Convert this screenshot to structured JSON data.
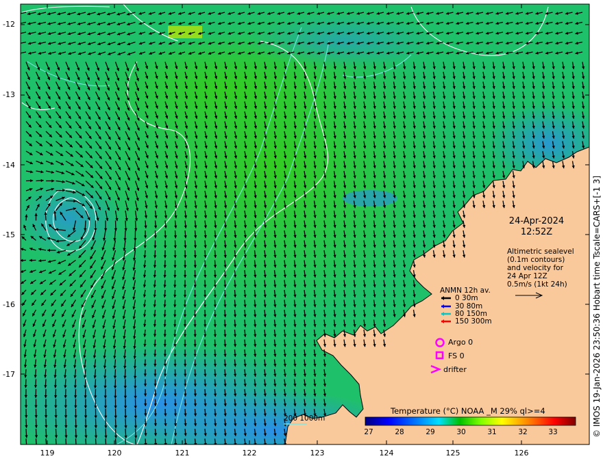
{
  "map": {
    "datetime_line1": "24-Apr-2024",
    "datetime_line2": "12:52Z",
    "altimetry_note": [
      "Altimetric sealevel",
      "(0.1m contours)",
      "and velocity for",
      "24 Apr 12Z",
      "0.5m/s (1kt 24h)"
    ],
    "lat_ticks": [
      "-12",
      "-13",
      "-14",
      "-15",
      "-16",
      "-17"
    ],
    "lon_ticks": [
      "119",
      "120",
      "121",
      "122",
      "123",
      "124",
      "125",
      "126"
    ],
    "credit": "© IMOS 19-Jan-2026 23:50:36 Hobart time Tscale=CARS+[-1 3]",
    "depth_contours_label": "200 1000m",
    "colors": {
      "land": "#f9c89b",
      "contour_white": "#ffffff",
      "contour_cyan": "#7ee8e8",
      "arrow": "#000000",
      "marker": "#ff00ff"
    }
  },
  "legend": {
    "title": "ANMN 12h av.",
    "rows": [
      {
        "label": "0 30m",
        "color": "#000000"
      },
      {
        "label": "30 80m",
        "color": "#0000ff"
      },
      {
        "label": "80 150m",
        "color": "#00c8c8"
      },
      {
        "label": "150 300m",
        "color": "#ff0000"
      }
    ],
    "markers": [
      {
        "label": "Argo 0",
        "icon": "circle-icon"
      },
      {
        "label": "FS 0",
        "icon": "square-icon"
      },
      {
        "label": "drifter",
        "icon": "chevron-right-icon"
      }
    ]
  },
  "colorbar": {
    "title": "Temperature (°C) NOAA _M 29% ql>=4",
    "ticks": [
      "27",
      "28",
      "29",
      "30",
      "31",
      "32",
      "33"
    ],
    "stops": [
      "#00007f",
      "#0000ff",
      "#0080ff",
      "#00ffff",
      "#00c000",
      "#80ff00",
      "#ffff00",
      "#ff8000",
      "#ff0000",
      "#800000"
    ]
  }
}
